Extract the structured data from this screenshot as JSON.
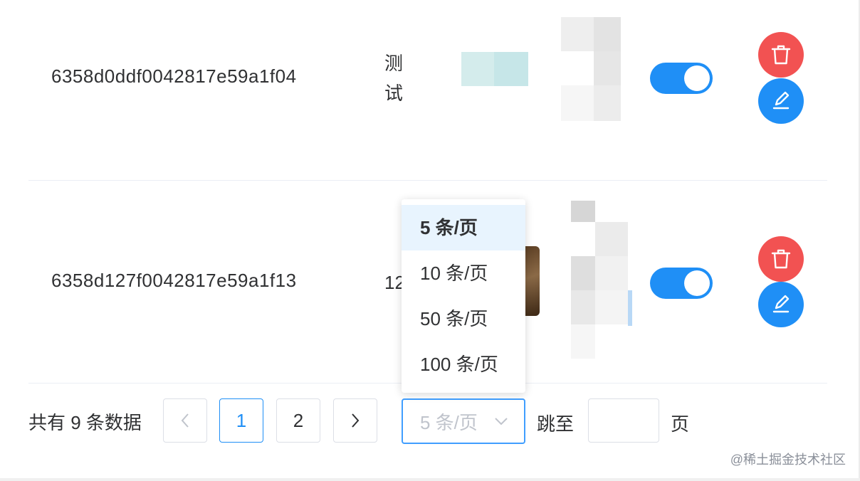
{
  "rows": [
    {
      "id": "6358d0ddf0042817e59a1f04",
      "name": "测试",
      "enabled": true
    },
    {
      "id": "6358d127f0042817e59a1f13",
      "name": "12",
      "enabled": true
    }
  ],
  "pagination": {
    "total_text": "共有 9 条数据",
    "pages": [
      "1",
      "2"
    ],
    "current_page": "1",
    "size_placeholder": "5 条/页",
    "jump_label": "跳至",
    "page_suffix": "页",
    "size_options": [
      "5 条/页",
      "10 条/页",
      "50 条/页",
      "100 条/页"
    ],
    "selected_size": "5 条/页"
  },
  "icons": {
    "delete": "trash-icon",
    "edit": "pencil-icon",
    "prev": "chevron-left-icon",
    "next": "chevron-right-icon",
    "dropdown": "chevron-down-icon"
  },
  "colors": {
    "primary": "#1f8ff6",
    "danger": "#f25252",
    "selected_bg": "#e8f4fe"
  },
  "watermark": "@稀土掘金技术社区"
}
